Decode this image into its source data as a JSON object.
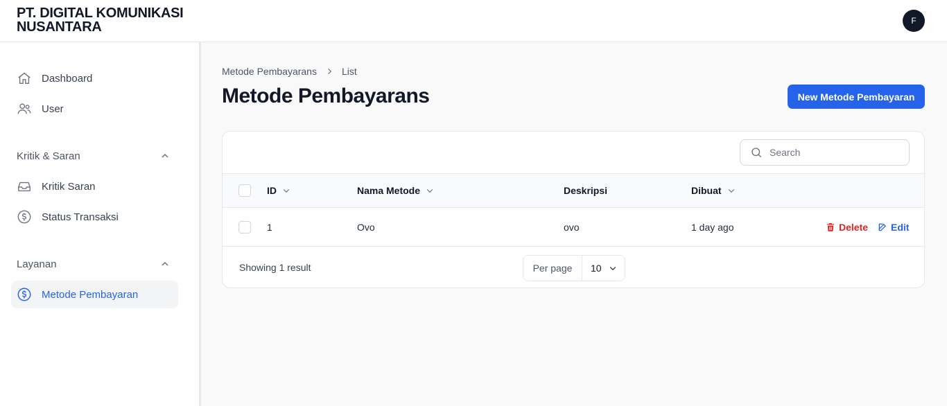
{
  "header": {
    "brand_line1": "PT. DIGITAL KOMUNIKASI",
    "brand_line2": "NUSANTARA",
    "avatar_initial": "F"
  },
  "sidebar": {
    "items": [
      {
        "label": "Dashboard",
        "icon": "home-icon"
      },
      {
        "label": "User",
        "icon": "users-icon"
      }
    ],
    "groups": [
      {
        "label": "Kritik & Saran",
        "items": [
          {
            "label": "Kritik Saran",
            "icon": "inbox-icon"
          },
          {
            "label": "Status Transaksi",
            "icon": "dollar-circle-icon"
          }
        ]
      },
      {
        "label": "Layanan",
        "items": [
          {
            "label": "Metode Pembayaran",
            "icon": "dollar-circle-icon",
            "active": true
          }
        ]
      }
    ]
  },
  "breadcrumb": {
    "parent": "Metode Pembayarans",
    "current": "List"
  },
  "page": {
    "title": "Metode Pembayarans",
    "new_button": "New Metode Pembayaran"
  },
  "table": {
    "search_placeholder": "Search",
    "columns": [
      "ID",
      "Nama Metode",
      "Deskripsi",
      "Dibuat"
    ],
    "rows": [
      {
        "id": "1",
        "nama_metode": "Ovo",
        "deskripsi": "ovo",
        "dibuat": "1 day ago"
      }
    ],
    "actions": {
      "delete": "Delete",
      "edit": "Edit"
    },
    "footer": {
      "showing": "Showing 1 result",
      "per_page_label": "Per page",
      "per_page_value": "10"
    }
  },
  "colors": {
    "primary": "#2563eb",
    "danger": "#dc2626"
  }
}
